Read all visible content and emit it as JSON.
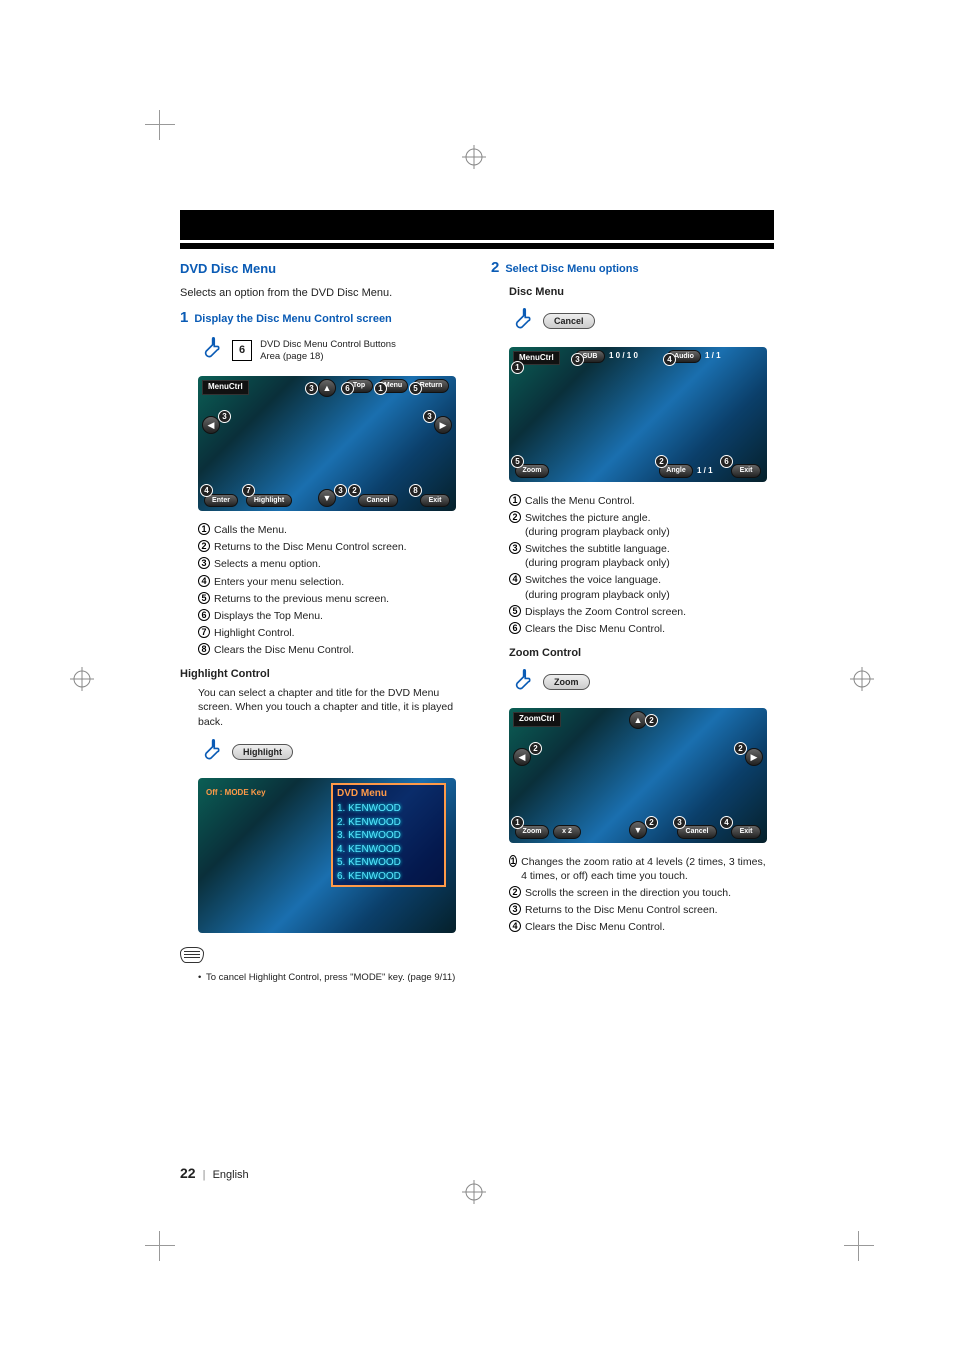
{
  "section_title": "DVD Disc Menu",
  "intro": "Selects an option from the DVD Disc Menu.",
  "step1": {
    "num": "1",
    "text": "Display the Disc Menu Control screen"
  },
  "step1_touch": {
    "key": "6",
    "caption": "DVD Disc Menu Control Buttons Area (page 18)"
  },
  "menuctrl": {
    "tag": "MenuCtrl",
    "btn_top": "Top",
    "btn_menu": "Menu",
    "btn_return": "Return",
    "btn_enter": "Enter",
    "btn_highlight": "Highlight",
    "btn_cancel": "Cancel",
    "btn_exit": "Exit"
  },
  "menuctrl_list": [
    "Calls the Menu.",
    "Returns to the Disc Menu Control screen.",
    "Selects a menu option.",
    "Enters your menu selection.",
    "Returns to the previous menu screen.",
    "Displays the Top Menu.",
    "Highlight Control.",
    "Clears the Disc Menu Control."
  ],
  "highlight_head": "Highlight Control",
  "highlight_para": "You can select a chapter and title for the DVD Menu screen. When you touch a chapter and title, it is played back.",
  "highlight_btn": "Highlight",
  "hc_shot": {
    "mode": "Off : MODE Key",
    "menu_title": "DVD Menu",
    "items": [
      "1. KENWOOD",
      "2. KENWOOD",
      "3. KENWOOD",
      "4. KENWOOD",
      "5. KENWOOD",
      "6. KENWOOD"
    ]
  },
  "note1": "To cancel Highlight Control, press \"MODE\" key. (page 9/11)",
  "step2": {
    "num": "2",
    "text": "Select Disc Menu options"
  },
  "discmenu_head": "Disc Menu",
  "discmenu_cancel": "Cancel",
  "discmenu": {
    "tag": "MenuCtrl",
    "sub_label": "SUB",
    "sub_val": "1 0 / 1 0",
    "audio_label": "Audio",
    "audio_val": "1 / 1",
    "zoom": "Zoom",
    "angle_label": "Angle",
    "angle_val": "1 / 1",
    "exit": "Exit"
  },
  "discmenu_list": [
    {
      "t": "Calls the Menu Control."
    },
    {
      "t": "Switches the picture angle.",
      "sub": "(during program playback only)"
    },
    {
      "t": "Switches the subtitle language.",
      "sub": "(during program playback only)"
    },
    {
      "t": "Switches the voice language.",
      "sub": "(during program playback only)"
    },
    {
      "t": "Displays the Zoom Control screen."
    },
    {
      "t": "Clears the Disc Menu Control."
    }
  ],
  "zoom_head": "Zoom Control",
  "zoom_btn": "Zoom",
  "zoomctrl": {
    "tag": "ZoomCtrl",
    "zoom_lbl": "Zoom",
    "zoom_val": "x 2",
    "cancel": "Cancel",
    "exit": "Exit"
  },
  "zoom_list": [
    "Changes the zoom ratio at 4 levels (2 times, 3 times, 4 times, or off) each time you touch.",
    "Scrolls the screen in the direction you touch.",
    "Returns to the Disc Menu Control screen.",
    "Clears the Disc Menu Control."
  ],
  "footer": {
    "page": "22",
    "lang": "English"
  }
}
